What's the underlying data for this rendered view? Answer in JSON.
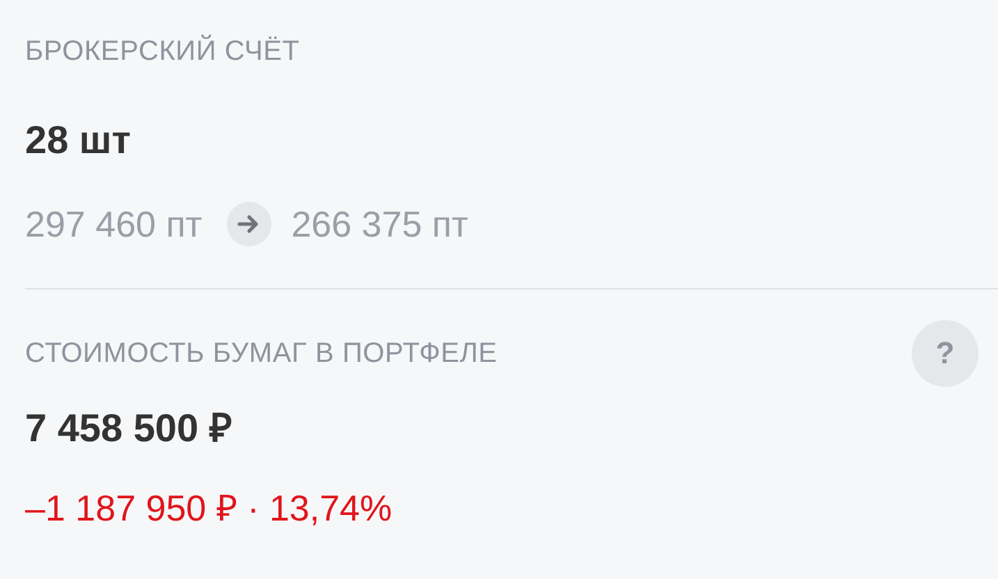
{
  "account": {
    "label": "БРОКЕРСКИЙ СЧЁТ",
    "quantity": "28 шт",
    "from": "297 460 пт",
    "to": "266 375 пт"
  },
  "portfolio": {
    "label": "СТОИМОСТЬ БУМАГ В ПОРТФЕЛЕ",
    "help": "?",
    "value": "7 458 500 ₽",
    "change": "–1 187 950 ₽ · 13,74%",
    "negative": true
  }
}
